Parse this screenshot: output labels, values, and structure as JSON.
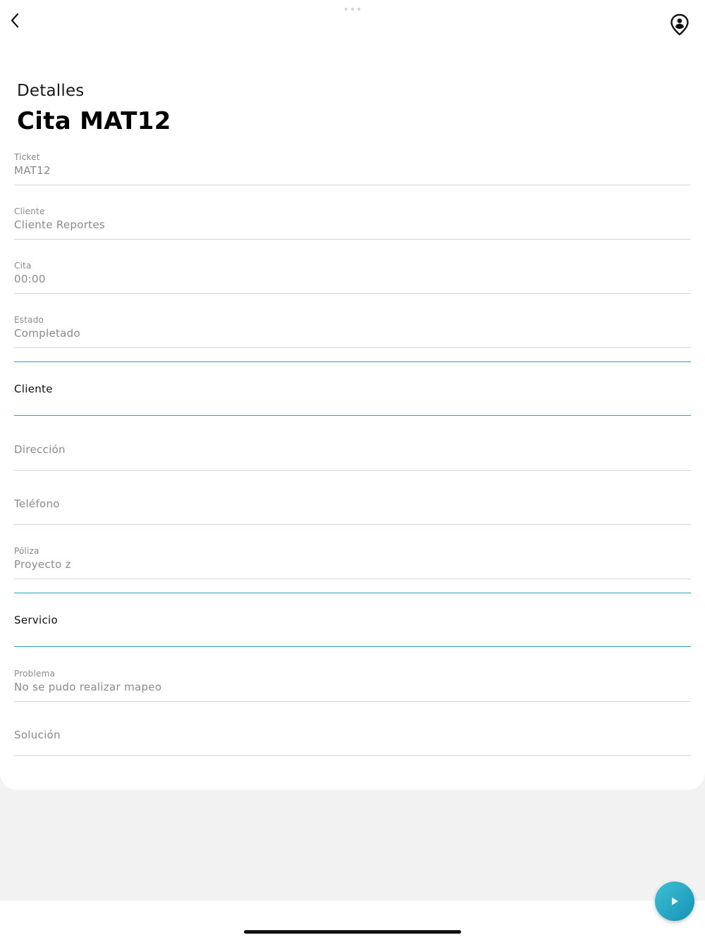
{
  "header": {
    "subtitle": "Detalles",
    "title": "Cita MAT12",
    "back_icon": "chevron-left-icon",
    "location_icon": "location-person-icon"
  },
  "fields": {
    "ticket": {
      "label": "Ticket",
      "value": "MAT12"
    },
    "cliente": {
      "label": "Cliente",
      "value": "Cliente Reportes"
    },
    "cita": {
      "label": "Cita",
      "value": "00:00"
    },
    "estado": {
      "label": "Estado",
      "value": "Completado"
    },
    "direccion": {
      "placeholder": "Dirección"
    },
    "telefono": {
      "placeholder": "Teléfono"
    },
    "poliza": {
      "label": "Póliza",
      "value": "Proyecto z"
    },
    "problema": {
      "label": "Problema",
      "value": "No se pudo realizar mapeo"
    },
    "solucion": {
      "placeholder": "Solución"
    }
  },
  "sections": {
    "cliente": "Cliente",
    "servicio": "Servicio"
  },
  "fab": {
    "icon": "play-icon"
  },
  "colors": {
    "accent": "#2aa5b6",
    "fab_start": "#3dc0d6",
    "fab_end": "#1493b4"
  }
}
